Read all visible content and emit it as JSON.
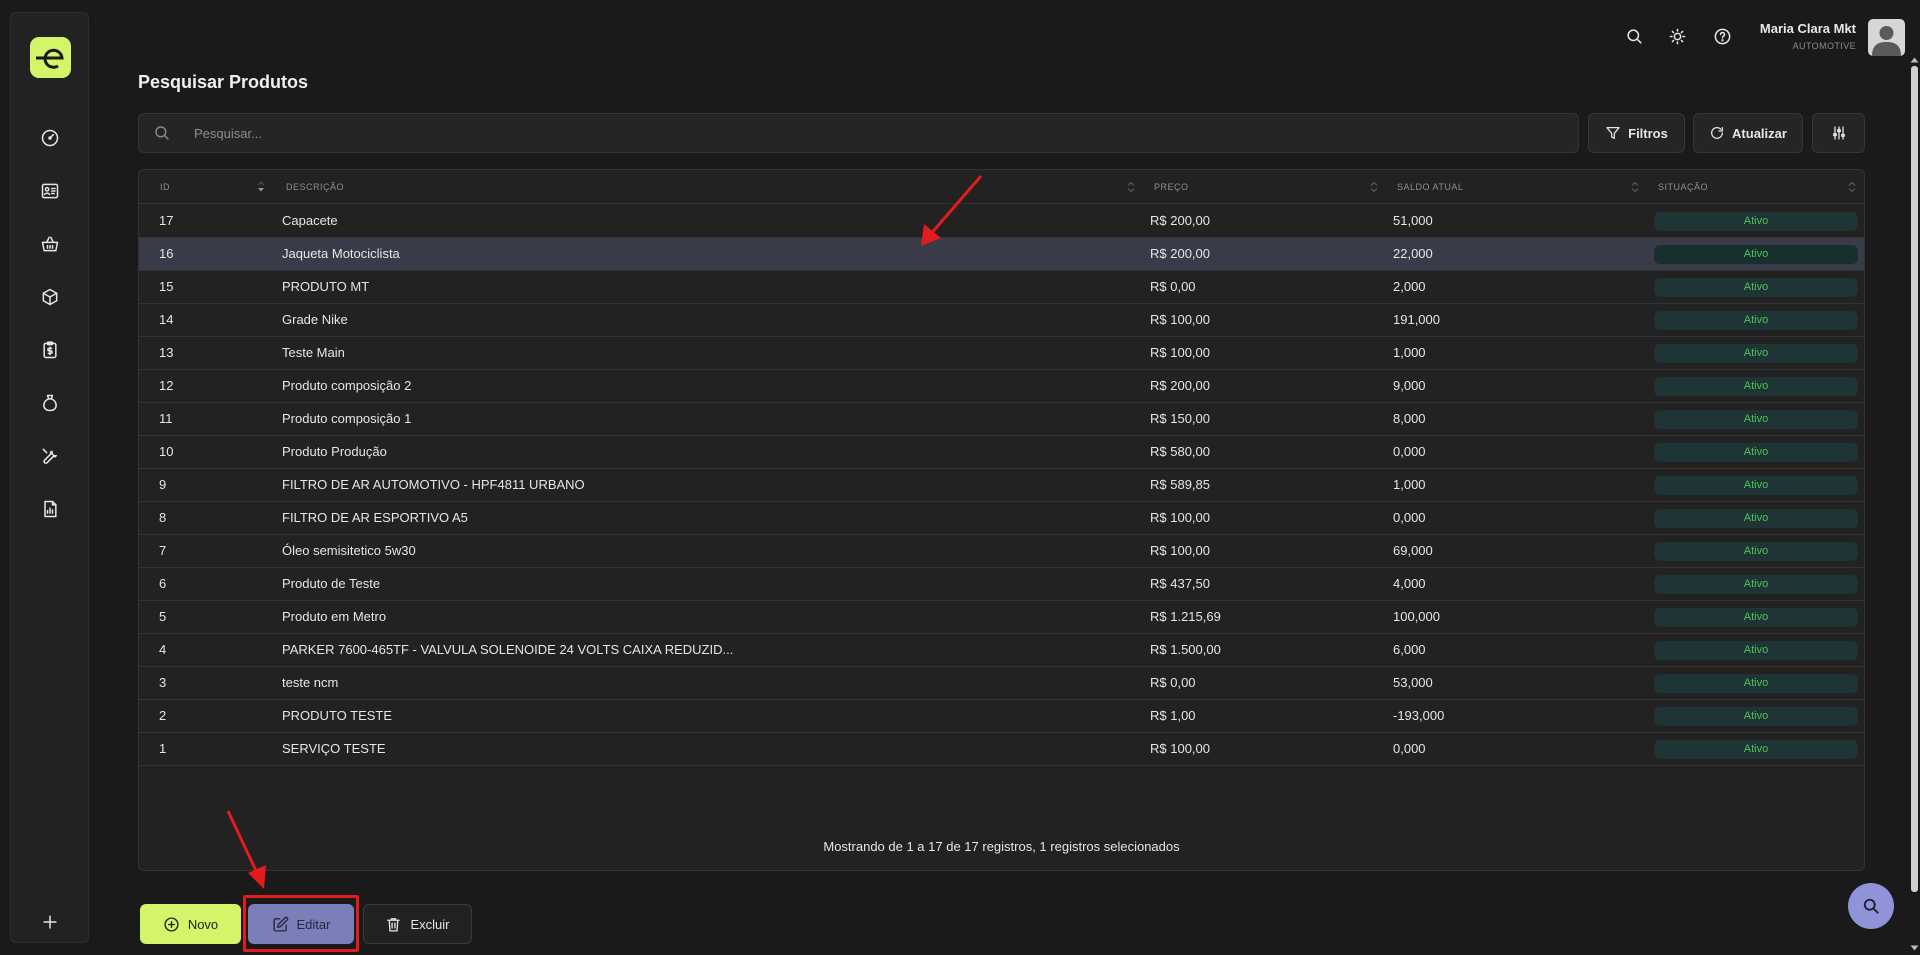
{
  "page": {
    "title": "Pesquisar Produtos"
  },
  "header": {
    "user_name": "Maria Clara Mkt",
    "user_company": "AUTOMOTIVE",
    "icons": [
      "search-icon",
      "sun-icon",
      "help-icon",
      "avatar"
    ]
  },
  "sidebar": {
    "logo": "e",
    "items": [
      {
        "icon": "dashboard-icon"
      },
      {
        "icon": "contacts-card-icon"
      },
      {
        "icon": "basket-icon"
      },
      {
        "icon": "box-icon"
      },
      {
        "icon": "clipboard-dollar-icon"
      },
      {
        "icon": "money-bag-icon"
      },
      {
        "icon": "wrench-icon"
      },
      {
        "icon": "report-icon"
      }
    ],
    "add_icon": "plus-icon"
  },
  "search": {
    "placeholder": "Pesquisar...",
    "value": ""
  },
  "toolbar": {
    "filters_label": "Filtros",
    "refresh_label": "Atualizar",
    "settings_icon": "sliders-icon"
  },
  "table": {
    "columns": [
      "ID",
      "DESCRIÇÃO",
      "PREÇO",
      "SALDO ATUAL",
      "SITUAÇÃO"
    ],
    "rows": [
      {
        "id": "17",
        "descricao": "Capacete",
        "preco": "R$ 200,00",
        "saldo": "51,000",
        "situacao": "Ativo",
        "selected": false
      },
      {
        "id": "16",
        "descricao": "Jaqueta Motociclista",
        "preco": "R$ 200,00",
        "saldo": "22,000",
        "situacao": "Ativo",
        "selected": true
      },
      {
        "id": "15",
        "descricao": "PRODUTO MT",
        "preco": "R$ 0,00",
        "saldo": "2,000",
        "situacao": "Ativo",
        "selected": false
      },
      {
        "id": "14",
        "descricao": "Grade Nike",
        "preco": "R$ 100,00",
        "saldo": "191,000",
        "situacao": "Ativo",
        "selected": false
      },
      {
        "id": "13",
        "descricao": "Teste Main",
        "preco": "R$ 100,00",
        "saldo": "1,000",
        "situacao": "Ativo",
        "selected": false
      },
      {
        "id": "12",
        "descricao": "Produto composição 2",
        "preco": "R$ 200,00",
        "saldo": "9,000",
        "situacao": "Ativo",
        "selected": false
      },
      {
        "id": "11",
        "descricao": "Produto composição 1",
        "preco": "R$ 150,00",
        "saldo": "8,000",
        "situacao": "Ativo",
        "selected": false
      },
      {
        "id": "10",
        "descricao": "Produto Produção",
        "preco": "R$ 580,00",
        "saldo": "0,000",
        "situacao": "Ativo",
        "selected": false
      },
      {
        "id": "9",
        "descricao": "FILTRO DE AR AUTOMOTIVO - HPF4811 URBANO",
        "preco": "R$ 589,85",
        "saldo": "1,000",
        "situacao": "Ativo",
        "selected": false
      },
      {
        "id": "8",
        "descricao": "FILTRO DE AR ESPORTIVO A5",
        "preco": "R$ 100,00",
        "saldo": "0,000",
        "situacao": "Ativo",
        "selected": false
      },
      {
        "id": "7",
        "descricao": "Óleo semisitetico 5w30",
        "preco": "R$ 100,00",
        "saldo": "69,000",
        "situacao": "Ativo",
        "selected": false
      },
      {
        "id": "6",
        "descricao": "Produto de Teste",
        "preco": "R$ 437,50",
        "saldo": "4,000",
        "situacao": "Ativo",
        "selected": false
      },
      {
        "id": "5",
        "descricao": "Produto em Metro",
        "preco": "R$ 1.215,69",
        "saldo": "100,000",
        "situacao": "Ativo",
        "selected": false
      },
      {
        "id": "4",
        "descricao": "PARKER 7600-465TF - VALVULA SOLENOIDE 24 VOLTS CAIXA REDUZID...",
        "preco": "R$ 1.500,00",
        "saldo": "6,000",
        "situacao": "Ativo",
        "selected": false
      },
      {
        "id": "3",
        "descricao": "teste ncm",
        "preco": "R$ 0,00",
        "saldo": "53,000",
        "situacao": "Ativo",
        "selected": false
      },
      {
        "id": "2",
        "descricao": "PRODUTO TESTE",
        "preco": "R$ 1,00",
        "saldo": "-193,000",
        "situacao": "Ativo",
        "selected": false
      },
      {
        "id": "1",
        "descricao": "SERVIÇO TESTE",
        "preco": "R$ 100,00",
        "saldo": "0,000",
        "situacao": "Ativo",
        "selected": false
      }
    ],
    "footer": "Mostrando de 1 a 17 de 17 registros, 1 registros selecionados"
  },
  "actions": {
    "new_label": "Novo",
    "edit_label": "Editar",
    "delete_label": "Excluir"
  },
  "colors": {
    "accent_lime": "#d4f46a",
    "accent_purple": "#7b7eb8",
    "status_green": "#4ec15a",
    "annotation_red": "#e21b1b"
  }
}
